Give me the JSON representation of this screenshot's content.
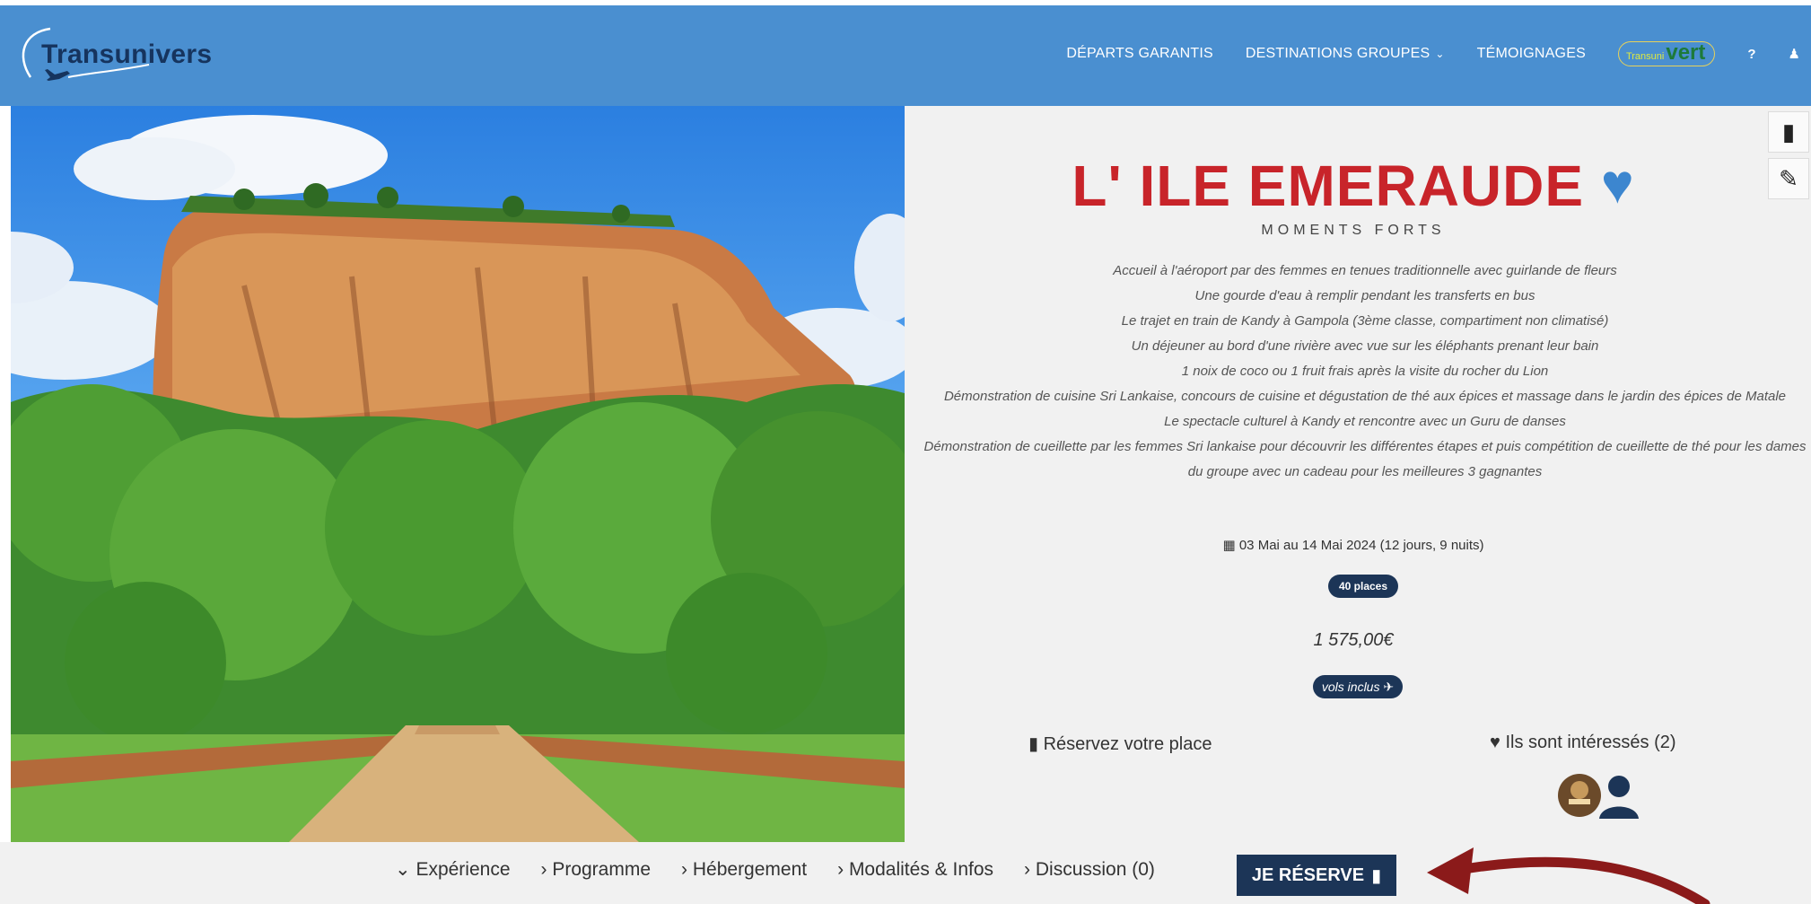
{
  "brand": {
    "name": "Transunivers"
  },
  "nav": {
    "items": [
      "DÉPARTS GARANTIS",
      "DESTINATIONS GROUPES",
      "TÉMOIGNAGES"
    ],
    "vert_small": "Transuni",
    "vert_big": "vert",
    "help_icon": "?",
    "user_icon": "♟"
  },
  "trip": {
    "title": "L' ILE EMERAUDE",
    "subtitle": "MOMENTS FORTS",
    "highlights": [
      "Accueil à l'aéroport par des femmes en tenues traditionnelle avec guirlande de fleurs",
      "Une gourde d'eau à remplir pendant les transferts en bus",
      "Le trajet en train de Kandy à Gampola (3ème classe, compartiment non climatisé)",
      "Un déjeuner au bord d'une rivière avec vue sur les éléphants prenant leur bain",
      "1 noix de coco ou 1 fruit frais après la visite du rocher du Lion",
      "Démonstration de cuisine Sri Lankaise, concours de cuisine et dégustation de thé aux épices et massage dans le jardin des épices de Matale",
      "Le spectacle culturel à Kandy et rencontre avec un Guru de danses",
      "Démonstration de cueillette par les femmes Sri lankaise pour découvrir les différentes étapes et puis compétition de cueillette de thé pour les dames du groupe avec un cadeau pour les meilleures 3 gagnantes"
    ],
    "dates": "03 Mai au 14 Mai 2024 (12 jours, 9 nuits)",
    "places": "40 places",
    "price": "1 575,00€",
    "flights": "vols inclus",
    "reserve_label": "Réservez votre place",
    "interested_label": "Ils sont intéressés (2)"
  },
  "tabs": [
    "Expérience",
    "Programme",
    "Hébergement",
    "Modalités & Infos",
    "Discussion (0)"
  ],
  "cta_label": "JE RÉSERVE",
  "colors": {
    "header_bg": "#4a8fd0",
    "title_red": "#c8242a",
    "navy": "#1c3557",
    "heart_blue": "#3c86cf",
    "panel_bg": "#f1f1f1",
    "arrow_red": "#8b1a1a"
  }
}
